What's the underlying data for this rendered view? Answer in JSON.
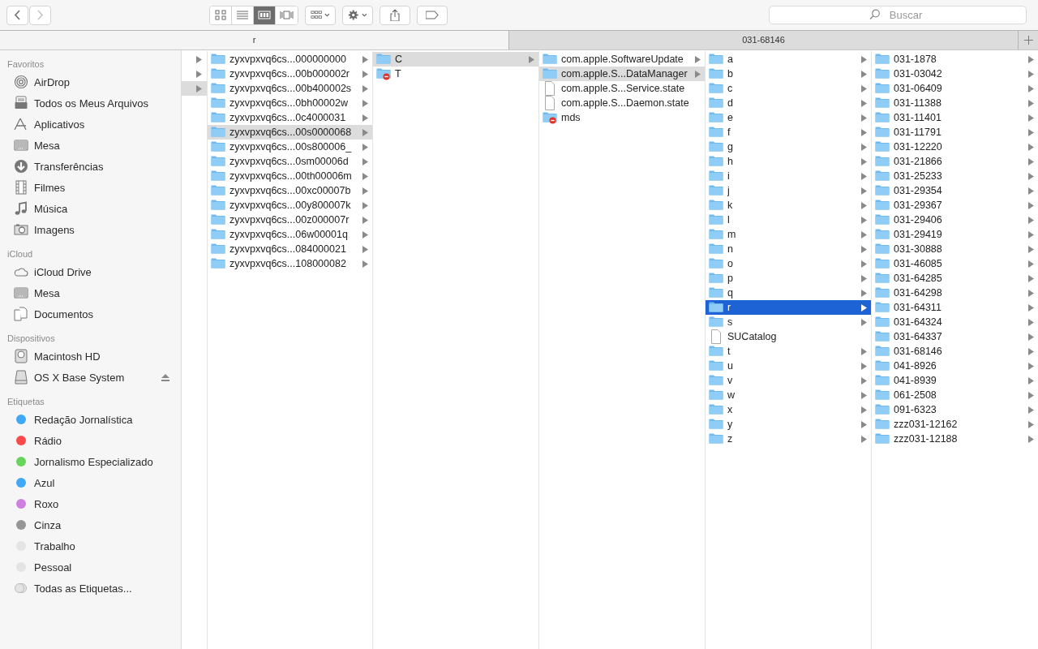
{
  "toolbar": {
    "navigation": [
      {
        "kind": "back",
        "disabled": false
      },
      {
        "kind": "forward",
        "disabled": true
      }
    ],
    "views": [
      {
        "kind": "icons",
        "selected": false
      },
      {
        "kind": "list",
        "selected": false
      },
      {
        "kind": "columns",
        "selected": true
      },
      {
        "kind": "coverflow",
        "selected": false
      }
    ],
    "actions": [
      {
        "kind": "arrange"
      },
      {
        "kind": "gear"
      },
      {
        "kind": "share"
      },
      {
        "kind": "tag"
      }
    ],
    "search": {
      "placeholder": "Buscar"
    }
  },
  "tabs": [
    {
      "label": "r",
      "selected": true
    },
    {
      "label": "031-68146",
      "selected": false
    }
  ],
  "sidebar": [
    {
      "title": "Favoritos",
      "items": [
        {
          "label": "AirDrop",
          "kind": "airdrop"
        },
        {
          "label": "Todos os Meus Arquivos",
          "kind": "files"
        },
        {
          "label": "Aplicativos",
          "kind": "apps"
        },
        {
          "label": "Mesa",
          "kind": "desktop"
        },
        {
          "label": "Transferências",
          "kind": "download"
        },
        {
          "label": "Filmes",
          "kind": "film"
        },
        {
          "label": "Música",
          "kind": "music"
        },
        {
          "label": "Imagens",
          "kind": "camera"
        }
      ]
    },
    {
      "title": "iCloud",
      "items": [
        {
          "label": "iCloud Drive",
          "kind": "cloud"
        },
        {
          "label": "Mesa",
          "kind": "desktop"
        },
        {
          "label": "Documentos",
          "kind": "docs"
        }
      ]
    },
    {
      "title": "Dispositivos",
      "items": [
        {
          "label": "Macintosh HD",
          "kind": "hd",
          "ejectable": false
        },
        {
          "label": "OS X Base System",
          "kind": "disk",
          "ejectable": true
        }
      ]
    },
    {
      "title": "Etiquetas",
      "items": [
        {
          "label": "Redação Jornalística",
          "kind": "tag",
          "color": "#3fa9f5"
        },
        {
          "label": "Rádio",
          "kind": "tag",
          "color": "#fc4a4a"
        },
        {
          "label": "Jornalismo Especializado",
          "kind": "tag",
          "color": "#67d55c"
        },
        {
          "label": "Azul",
          "kind": "tag",
          "color": "#3fa9f5"
        },
        {
          "label": "Roxo",
          "kind": "tag",
          "color": "#cf7fe0"
        },
        {
          "label": "Cinza",
          "kind": "tag",
          "color": "#969696"
        },
        {
          "label": "Trabalho",
          "kind": "tag",
          "color": "#e4e4e4"
        },
        {
          "label": "Pessoal",
          "kind": "tag",
          "color": "#e4e4e4"
        },
        {
          "label": "Todas as Etiquetas...",
          "kind": "alltags"
        }
      ]
    }
  ],
  "columns": [
    {
      "focused": false,
      "items": [
        {
          "selected": false,
          "expandable": true
        },
        {
          "selected": false,
          "expandable": true
        },
        {
          "selected": true,
          "expandable": true
        }
      ]
    },
    {
      "focused": false,
      "items": [
        {
          "name": "zyxvpxvq6cs...000000000",
          "kind": "folder",
          "expandable": true,
          "selected": false
        },
        {
          "name": "zyxvpxvq6cs...00b000002r",
          "kind": "folder",
          "expandable": true,
          "selected": false
        },
        {
          "name": "zyxvpxvq6cs...00b400002s",
          "kind": "folder",
          "expandable": true,
          "selected": false
        },
        {
          "name": "zyxvpxvq6cs...0bh00002w",
          "kind": "folder",
          "expandable": true,
          "selected": false
        },
        {
          "name": "zyxvpxvq6cs...0c4000031",
          "kind": "folder",
          "expandable": true,
          "selected": false
        },
        {
          "name": "zyxvpxvq6cs...00s0000068",
          "kind": "folder",
          "expandable": true,
          "selected": true
        },
        {
          "name": "zyxvpxvq6cs...00s800006_",
          "kind": "folder",
          "expandable": true,
          "selected": false
        },
        {
          "name": "zyxvpxvq6cs...0sm00006d",
          "kind": "folder",
          "expandable": true,
          "selected": false
        },
        {
          "name": "zyxvpxvq6cs...00th00006m",
          "kind": "folder",
          "expandable": true,
          "selected": false
        },
        {
          "name": "zyxvpxvq6cs...00xc00007b",
          "kind": "folder",
          "expandable": true,
          "selected": false
        },
        {
          "name": "zyxvpxvq6cs...00y800007k",
          "kind": "folder",
          "expandable": true,
          "selected": false
        },
        {
          "name": "zyxvpxvq6cs...00z000007r",
          "kind": "folder",
          "expandable": true,
          "selected": false
        },
        {
          "name": "zyxvpxvq6cs...06w00001q",
          "kind": "folder",
          "expandable": true,
          "selected": false
        },
        {
          "name": "zyxvpxvq6cs...084000021",
          "kind": "folder",
          "expandable": true,
          "selected": false
        },
        {
          "name": "zyxvpxvq6cs...108000082",
          "kind": "folder",
          "expandable": true,
          "selected": false
        }
      ]
    },
    {
      "focused": false,
      "items": [
        {
          "name": "C",
          "kind": "folder",
          "expandable": true,
          "selected": true
        },
        {
          "name": "T",
          "kind": "restricted-folder",
          "expandable": false,
          "selected": false
        }
      ]
    },
    {
      "focused": false,
      "items": [
        {
          "name": "com.apple.SoftwareUpdate",
          "kind": "folder",
          "expandable": true,
          "selected": false
        },
        {
          "name": "com.apple.S...DataManager",
          "kind": "folder",
          "expandable": true,
          "selected": true
        },
        {
          "name": "com.apple.S...Service.state",
          "kind": "file",
          "expandable": false,
          "selected": false
        },
        {
          "name": "com.apple.S...Daemon.state",
          "kind": "file",
          "expandable": false,
          "selected": false
        },
        {
          "name": "mds",
          "kind": "restricted-folder",
          "expandable": false,
          "selected": false
        }
      ]
    },
    {
      "focused": true,
      "items": [
        {
          "name": "a",
          "kind": "folder",
          "expandable": true,
          "selected": false
        },
        {
          "name": "b",
          "kind": "folder",
          "expandable": true,
          "selected": false
        },
        {
          "name": "c",
          "kind": "folder",
          "expandable": true,
          "selected": false
        },
        {
          "name": "d",
          "kind": "folder",
          "expandable": true,
          "selected": false
        },
        {
          "name": "e",
          "kind": "folder",
          "expandable": true,
          "selected": false
        },
        {
          "name": "f",
          "kind": "folder",
          "expandable": true,
          "selected": false
        },
        {
          "name": "g",
          "kind": "folder",
          "expandable": true,
          "selected": false
        },
        {
          "name": "h",
          "kind": "folder",
          "expandable": true,
          "selected": false
        },
        {
          "name": "i",
          "kind": "folder",
          "expandable": true,
          "selected": false
        },
        {
          "name": "j",
          "kind": "folder",
          "expandable": true,
          "selected": false
        },
        {
          "name": "k",
          "kind": "folder",
          "expandable": true,
          "selected": false
        },
        {
          "name": "l",
          "kind": "folder",
          "expandable": true,
          "selected": false
        },
        {
          "name": "m",
          "kind": "folder",
          "expandable": true,
          "selected": false
        },
        {
          "name": "n",
          "kind": "folder",
          "expandable": true,
          "selected": false
        },
        {
          "name": "o",
          "kind": "folder",
          "expandable": true,
          "selected": false
        },
        {
          "name": "p",
          "kind": "folder",
          "expandable": true,
          "selected": false
        },
        {
          "name": "q",
          "kind": "folder",
          "expandable": true,
          "selected": false
        },
        {
          "name": "r",
          "kind": "folder",
          "expandable": true,
          "selected": true
        },
        {
          "name": "s",
          "kind": "folder",
          "expandable": true,
          "selected": false
        },
        {
          "name": "SUCatalog",
          "kind": "file",
          "expandable": false,
          "selected": false
        },
        {
          "name": "t",
          "kind": "folder",
          "expandable": true,
          "selected": false
        },
        {
          "name": "u",
          "kind": "folder",
          "expandable": true,
          "selected": false
        },
        {
          "name": "v",
          "kind": "folder",
          "expandable": true,
          "selected": false
        },
        {
          "name": "w",
          "kind": "folder",
          "expandable": true,
          "selected": false
        },
        {
          "name": "x",
          "kind": "folder",
          "expandable": true,
          "selected": false
        },
        {
          "name": "y",
          "kind": "folder",
          "expandable": true,
          "selected": false
        },
        {
          "name": "z",
          "kind": "folder",
          "expandable": true,
          "selected": false
        }
      ]
    },
    {
      "items": [
        {
          "name": "031-1878",
          "kind": "folder",
          "expandable": true,
          "selected": false
        },
        {
          "name": "031-03042",
          "kind": "folder",
          "expandable": true,
          "selected": false
        },
        {
          "name": "031-06409",
          "kind": "folder",
          "expandable": true,
          "selected": false
        },
        {
          "name": "031-11388",
          "kind": "folder",
          "expandable": true,
          "selected": false
        },
        {
          "name": "031-11401",
          "kind": "folder",
          "expandable": true,
          "selected": false
        },
        {
          "name": "031-11791",
          "kind": "folder",
          "expandable": true,
          "selected": false
        },
        {
          "name": "031-12220",
          "kind": "folder",
          "expandable": true,
          "selected": false
        },
        {
          "name": "031-21866",
          "kind": "folder",
          "expandable": true,
          "selected": false
        },
        {
          "name": "031-25233",
          "kind": "folder",
          "expandable": true,
          "selected": false
        },
        {
          "name": "031-29354",
          "kind": "folder",
          "expandable": true,
          "selected": false
        },
        {
          "name": "031-29367",
          "kind": "folder",
          "expandable": true,
          "selected": false
        },
        {
          "name": "031-29406",
          "kind": "folder",
          "expandable": true,
          "selected": false
        },
        {
          "name": "031-29419",
          "kind": "folder",
          "expandable": true,
          "selected": false
        },
        {
          "name": "031-30888",
          "kind": "folder",
          "expandable": true,
          "selected": false
        },
        {
          "name": "031-46085",
          "kind": "folder",
          "expandable": true,
          "selected": false
        },
        {
          "name": "031-64285",
          "kind": "folder",
          "expandable": true,
          "selected": false
        },
        {
          "name": "031-64298",
          "kind": "folder",
          "expandable": true,
          "selected": false
        },
        {
          "name": "031-64311",
          "kind": "folder",
          "expandable": true,
          "selected": false
        },
        {
          "name": "031-64324",
          "kind": "folder",
          "expandable": true,
          "selected": false
        },
        {
          "name": "031-64337",
          "kind": "folder",
          "expandable": true,
          "selected": false
        },
        {
          "name": "031-68146",
          "kind": "folder",
          "expandable": true,
          "selected": false
        },
        {
          "name": "041-8926",
          "kind": "folder",
          "expandable": true,
          "selected": false
        },
        {
          "name": "041-8939",
          "kind": "folder",
          "expandable": true,
          "selected": false
        },
        {
          "name": "061-2508",
          "kind": "folder",
          "expandable": true,
          "selected": false
        },
        {
          "name": "091-6323",
          "kind": "folder",
          "expandable": true,
          "selected": false
        },
        {
          "name": "zzz031-12162",
          "kind": "folder",
          "expandable": true,
          "selected": false
        },
        {
          "name": "zzz031-12188",
          "kind": "folder",
          "expandable": true,
          "selected": false
        }
      ]
    }
  ]
}
